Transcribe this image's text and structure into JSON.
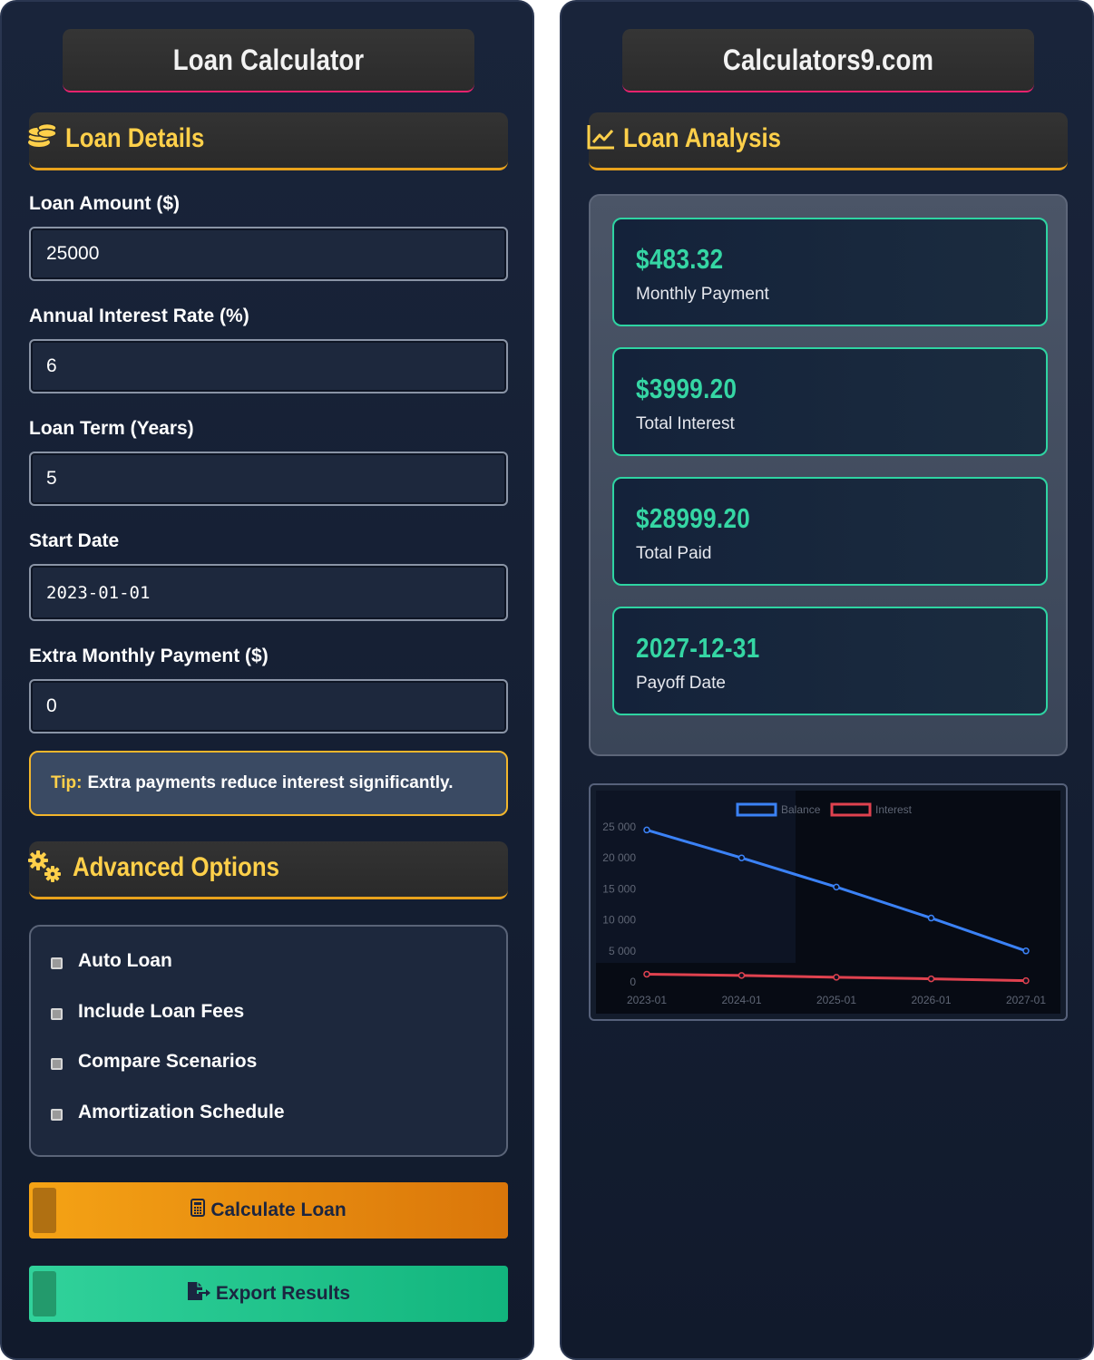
{
  "left": {
    "title": "Loan Calculator",
    "details_header": "Loan Details",
    "fields": [
      {
        "label": "Loan Amount ($)",
        "value": "25000"
      },
      {
        "label": "Annual Interest Rate (%)",
        "value": "6"
      },
      {
        "label": "Loan Term (Years)",
        "value": "5"
      },
      {
        "label": "Start Date",
        "value": "2023-01-01"
      },
      {
        "label": "Extra Monthly Payment ($)",
        "value": "0"
      }
    ],
    "tip": {
      "key": "Tip:",
      "text": "Extra payments reduce interest significantly."
    },
    "advanced_header": "Advanced Options",
    "options": [
      "Auto Loan",
      "Include Loan Fees",
      "Compare Scenarios",
      "Amortization Schedule"
    ],
    "calculate_label": "Calculate Loan",
    "export_label": "Export Results"
  },
  "right": {
    "title": "Calculators9.com",
    "analysis_header": "Loan Analysis",
    "stats": [
      {
        "value": "$483.32",
        "label": "Monthly Payment"
      },
      {
        "value": "$3999.20",
        "label": "Total Interest"
      },
      {
        "value": "$28999.20",
        "label": "Total Paid"
      },
      {
        "value": "2027-12-31",
        "label": "Payoff Date"
      }
    ]
  },
  "colors": {
    "accent_gold": "#ffd04a",
    "accent_green": "#35d6a4",
    "balance_line": "#3b82f6",
    "interest_line": "#e0424f"
  },
  "chart_data": {
    "type": "line",
    "categories": [
      "2023-01",
      "2024-01",
      "2025-01",
      "2026-01",
      "2027-01"
    ],
    "series": [
      {
        "name": "Balance",
        "values": [
          24500,
          20000,
          15300,
          10300,
          5000
        ]
      },
      {
        "name": "Interest",
        "values": [
          1250,
          1050,
          750,
          500,
          200
        ]
      }
    ],
    "y_ticks": [
      "0",
      "5 000",
      "10 000",
      "15 000",
      "20 000",
      "25 000"
    ],
    "ylim": [
      0,
      25000
    ],
    "legend_position": "top-center",
    "grid": false
  }
}
